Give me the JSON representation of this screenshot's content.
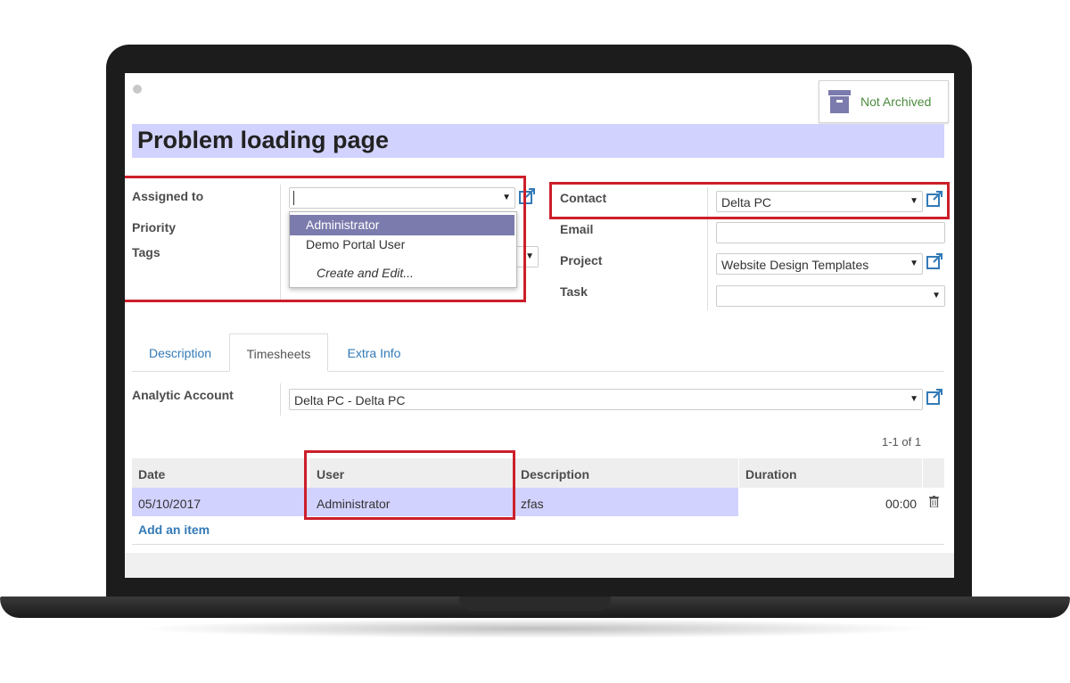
{
  "status": {
    "archive_label": "Not Archived"
  },
  "title": "Problem loading page",
  "left_fields": {
    "assigned_to_label": "Assigned to",
    "priority_label": "Priority",
    "tags_label": "Tags",
    "assigned_to_value": ""
  },
  "dropdown": {
    "items": [
      "Administrator",
      "Demo Portal User"
    ],
    "create_label": "Create and Edit..."
  },
  "right_fields": {
    "contact_label": "Contact",
    "contact_value": "Delta PC",
    "email_label": "Email",
    "email_value": "",
    "project_label": "Project",
    "project_value": "Website Design Templates",
    "task_label": "Task",
    "task_value": ""
  },
  "tabs": [
    {
      "label": "Description",
      "active": false
    },
    {
      "label": "Timesheets",
      "active": true
    },
    {
      "label": "Extra Info",
      "active": false
    }
  ],
  "analytic": {
    "label": "Analytic Account",
    "value": "Delta PC - Delta PC"
  },
  "pager": "1-1 of 1",
  "table": {
    "columns": [
      "Date",
      "User",
      "Description",
      "Duration"
    ],
    "rows": [
      {
        "date": "05/10/2017",
        "user": "Administrator",
        "description": "zfas",
        "duration": "00:00"
      }
    ],
    "add_label": "Add an item"
  },
  "colors": {
    "highlight": "#d2d2ff",
    "accent": "#7c7bad",
    "annotation_red": "#cc1f2a",
    "link": "#337ab7"
  }
}
